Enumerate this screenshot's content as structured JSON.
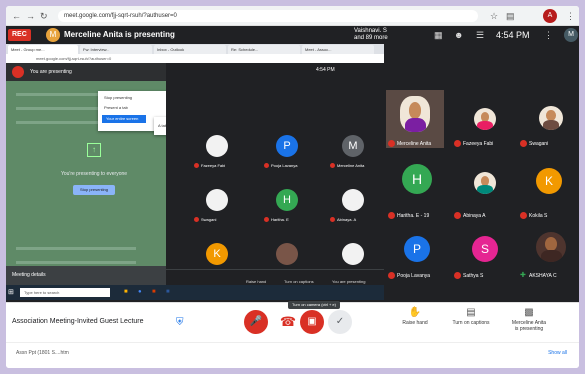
{
  "browser": {
    "url": "meet.google.com/fjj-sqrt-rsuh/?authuser=0",
    "profile": "A"
  },
  "topbar": {
    "rec": "REC",
    "presenter_initial": "M",
    "presenter_title": "Merceline Anita is presenting",
    "viewers_line1": "Vaishnavi. S",
    "viewers_line2": "and 89 more",
    "time": "4:54 PM",
    "me_initial": "M"
  },
  "share": {
    "tabs": [
      "Meet - Group me...",
      "Fw: Interview..",
      "Inbox - Outlook",
      "Re: Schedule...",
      "Meet - Assoc..."
    ],
    "left_header": "You are presenting",
    "card_title": "You're presenting to everyone",
    "card_button": "Stop presenting",
    "popup_items": [
      "Stop presenting",
      "Present a tab",
      "Your entire screen"
    ],
    "popup_submenu": "A tab",
    "inner_time": "4:54 PM",
    "meeting_details": "Meeting details",
    "search": "Type here to search",
    "tiles": [
      {
        "initial": "",
        "name": "Fazeeya Fabi",
        "color": "#f2f2f2"
      },
      {
        "initial": "P",
        "name": "Pooja Lavanya",
        "color": "#1a73e8"
      },
      {
        "initial": "M",
        "name": "Merceline Anita",
        "color": "#5f6368"
      },
      {
        "initial": "",
        "name": "Swagani",
        "color": "#f2f2f2"
      },
      {
        "initial": "H",
        "name": "Haritha. E",
        "color": "#34a853"
      },
      {
        "initial": "",
        "name": "Abinaya. A",
        "color": "#f2f2f2"
      },
      {
        "initial": "K",
        "name": "Kokila S",
        "color": "#f29900"
      },
      {
        "initial": "",
        "name": "AKSHAYA C",
        "color": "#795548"
      },
      {
        "initial": "",
        "name": "Janu S",
        "color": "#f2f2f2"
      }
    ],
    "inner_controls": [
      "Raise hand",
      "Turn on captions",
      "You are presenting"
    ]
  },
  "grid": [
    {
      "initial": "",
      "name": "Merceline Anita",
      "mic": "red"
    },
    {
      "initial": "",
      "name": "Fazeeya Fabi",
      "mic": "red"
    },
    {
      "initial": "",
      "name": "Swagani",
      "mic": "red"
    },
    {
      "initial": "H",
      "name": "Haritha. E - 19",
      "mic": "red",
      "color": "#34a853"
    },
    {
      "initial": "",
      "name": "Abinaya A",
      "mic": "red"
    },
    {
      "initial": "K",
      "name": "Kokila S",
      "mic": "red",
      "color": "#f29900"
    },
    {
      "initial": "P",
      "name": "Pooja Lavanya",
      "mic": "red",
      "color": "#1a73e8"
    },
    {
      "initial": "S",
      "name": "Sathya S",
      "mic": "red",
      "color": "#e52592"
    },
    {
      "initial": "",
      "name": "AKSHAYA C",
      "mic": "green"
    }
  ],
  "bottom": {
    "meeting_title": "Association Meeting-Invited Guest Lecture",
    "tooltip": "Turn on camera (ctrl + e)",
    "raise_hand": "Raise hand",
    "captions": "Turn on captions",
    "presenting_line1": "Merceline Anita",
    "presenting_line2": "is presenting"
  },
  "status": {
    "left": "Assn Ppt (1801 S....htm",
    "right": "Show all"
  }
}
